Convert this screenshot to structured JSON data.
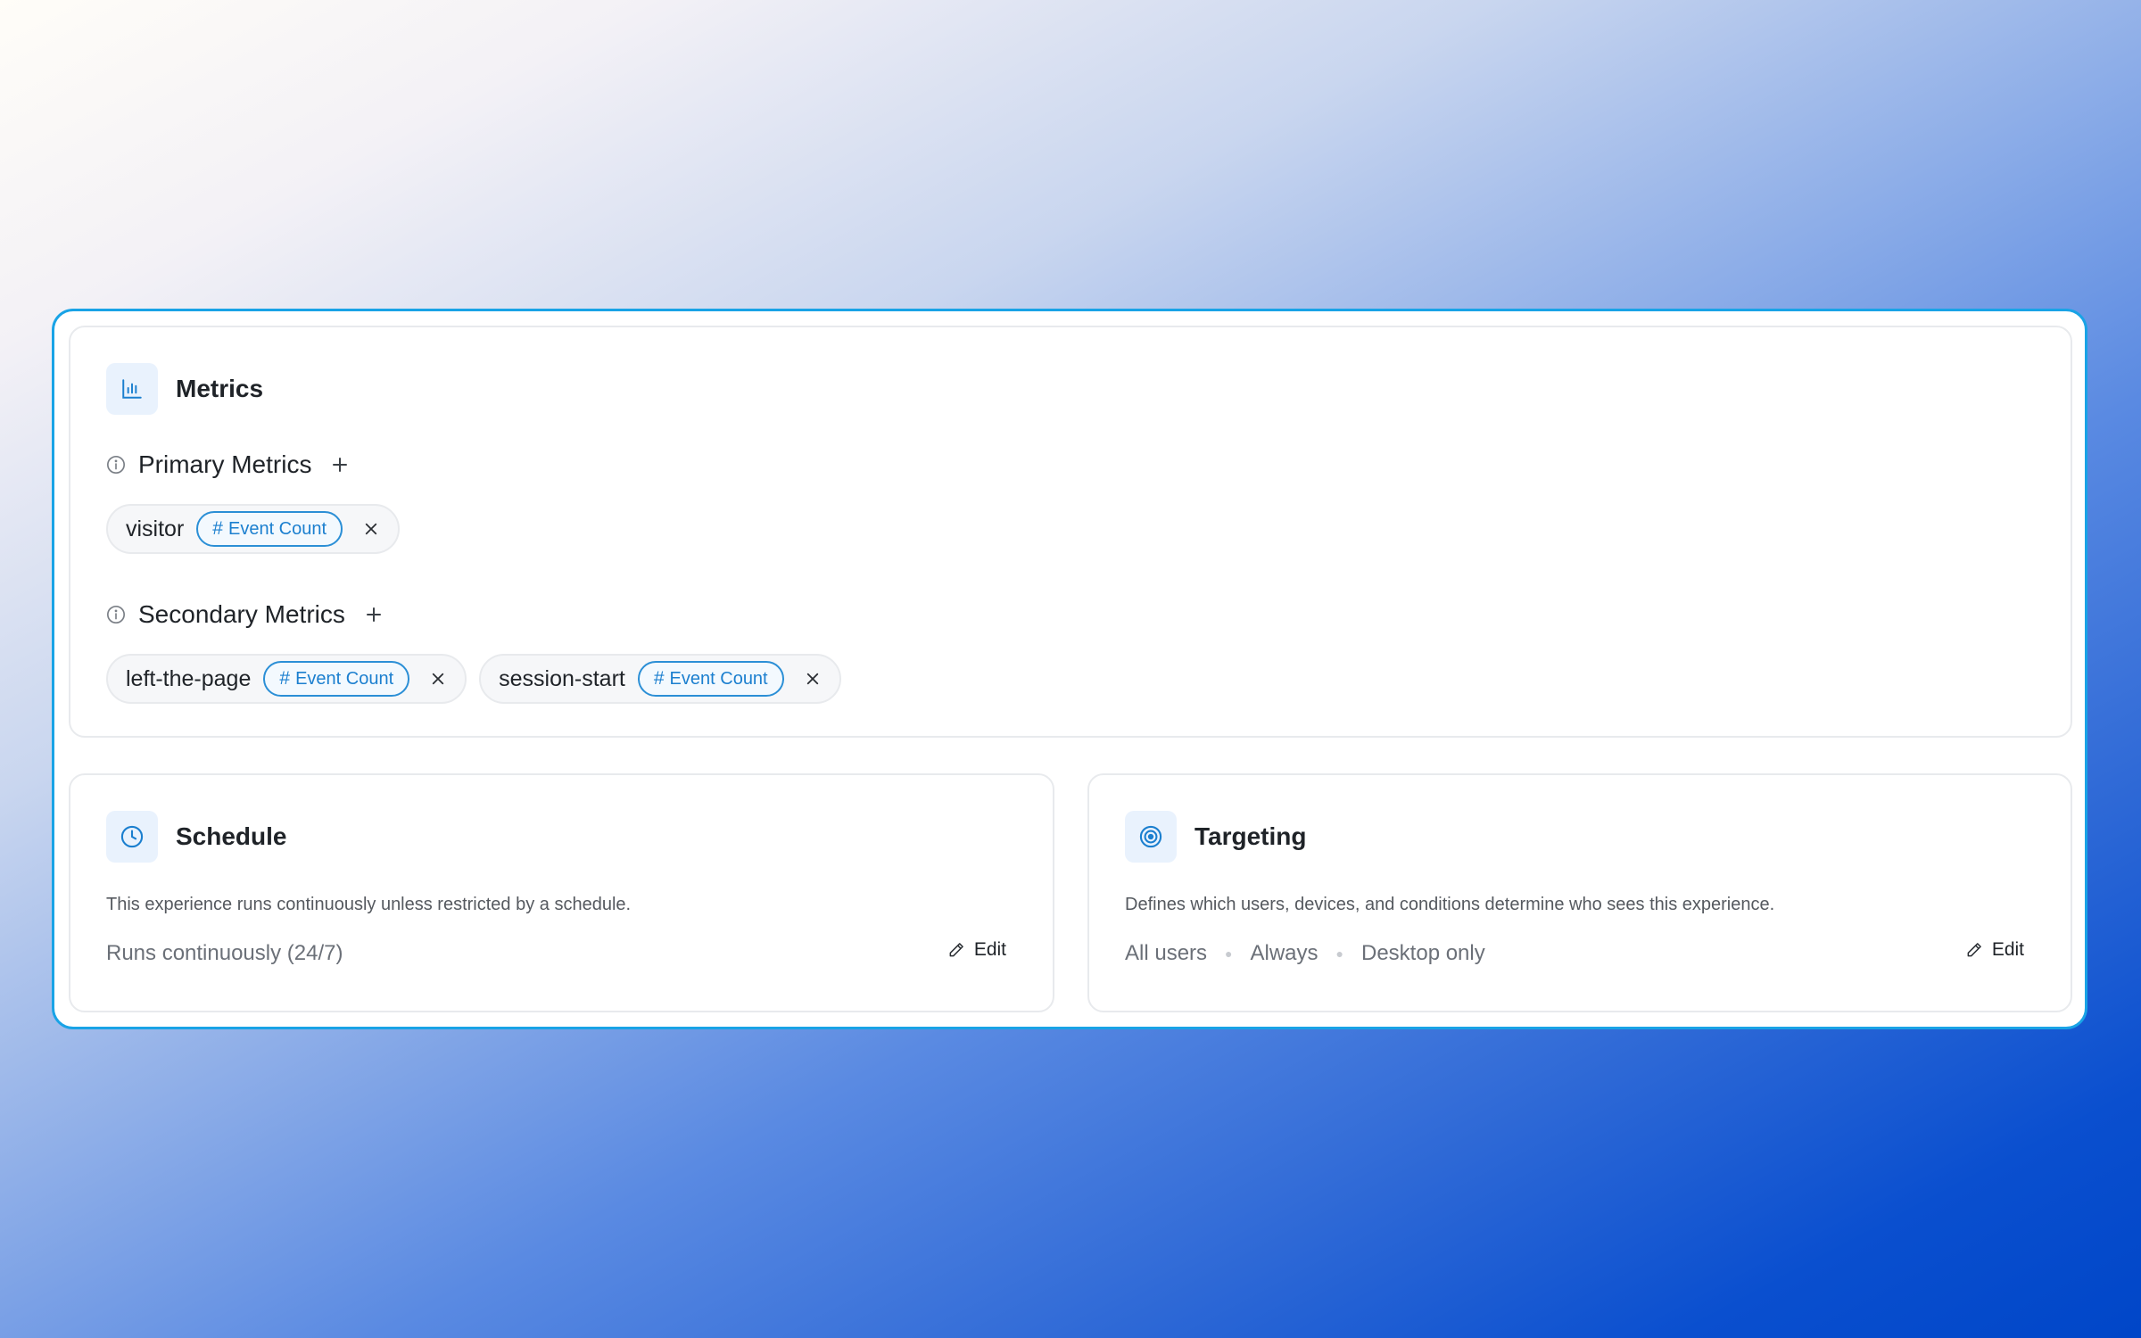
{
  "metrics": {
    "title": "Metrics",
    "icon": "bar-chart-icon",
    "primary": {
      "label": "Primary Metrics",
      "items": [
        {
          "name": "visitor",
          "type": "Event Count"
        }
      ]
    },
    "secondary": {
      "label": "Secondary Metrics",
      "items": [
        {
          "name": "left-the-page",
          "type": "Event Count"
        },
        {
          "name": "session-start",
          "type": "Event Count"
        }
      ]
    }
  },
  "schedule": {
    "title": "Schedule",
    "icon": "clock-icon",
    "description": "This experience runs continuously unless restricted by a schedule.",
    "status": "Runs continuously (24/7)",
    "edit_label": "Edit"
  },
  "targeting": {
    "title": "Targeting",
    "icon": "target-icon",
    "description": "Defines which users, devices, and conditions determine who sees this experience.",
    "conditions": [
      "All users",
      "Always",
      "Desktop only"
    ],
    "edit_label": "Edit"
  },
  "colors": {
    "accent": "#1b7fcf",
    "frame_border": "#19a3e6",
    "icon_bg": "#e9f2fd"
  }
}
